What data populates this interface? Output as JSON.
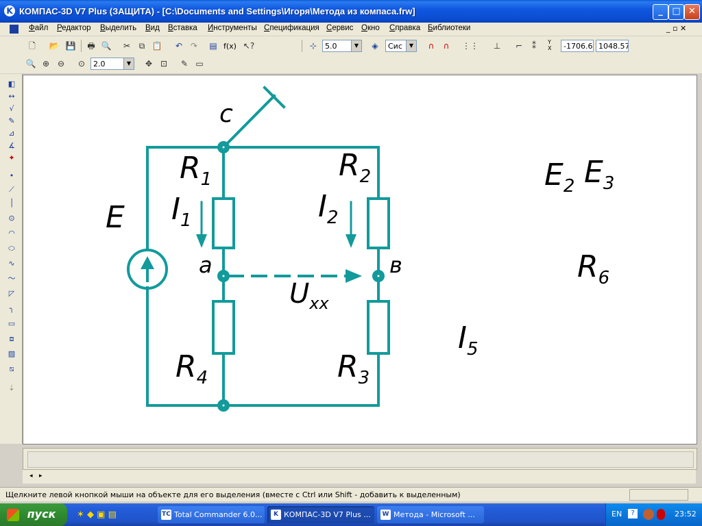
{
  "window": {
    "title": "КОМПАС-3D V7 Plus (ЗАЩИТА) - [C:\\Documents and Settings\\Игоря\\Метода из компаса.frw]",
    "icon": "K"
  },
  "menu": [
    "Файл",
    "Редактор",
    "Выделить",
    "Вид",
    "Вставка",
    "Инструменты",
    "Спецификация",
    "Сервис",
    "Окно",
    "Справка",
    "Библиотеки"
  ],
  "toolbar": {
    "step_value": "5.0",
    "style_value": "Сис",
    "coord_x": "-1706.6",
    "coord_y": "1048.57",
    "zoom_value": "2.0",
    "fx_label": "f(x)"
  },
  "schematic": {
    "node_c": "c",
    "node_a": "a",
    "node_b": "в",
    "E": "E",
    "R1": {
      "base": "R",
      "sub": "1"
    },
    "R2": {
      "base": "R",
      "sub": "2"
    },
    "R3": {
      "base": "R",
      "sub": "3"
    },
    "R4": {
      "base": "R",
      "sub": "4"
    },
    "R6": {
      "base": "R",
      "sub": "6"
    },
    "I1": {
      "base": "I",
      "sub": "1"
    },
    "I2": {
      "base": "I",
      "sub": "2"
    },
    "I5": {
      "base": "I",
      "sub": "5"
    },
    "E2": {
      "base": "E",
      "sub": "2"
    },
    "E3": {
      "base": "E",
      "sub": "3"
    },
    "Uxx": {
      "base": "U",
      "sub": "xx"
    },
    "color": "#139a9a"
  },
  "status": {
    "hint": "Щелкните левой кнопкой мыши на объекте для его выделения (вместе с Ctrl или Shift - добавить к выделенным)"
  },
  "taskbar": {
    "start_label": "пуск",
    "tasks": [
      "Total Commander 6.0...",
      "КОМПАС-3D V7 Plus ...",
      "Метода - Microsoft ..."
    ],
    "lang": "EN",
    "clock": "23:52"
  }
}
